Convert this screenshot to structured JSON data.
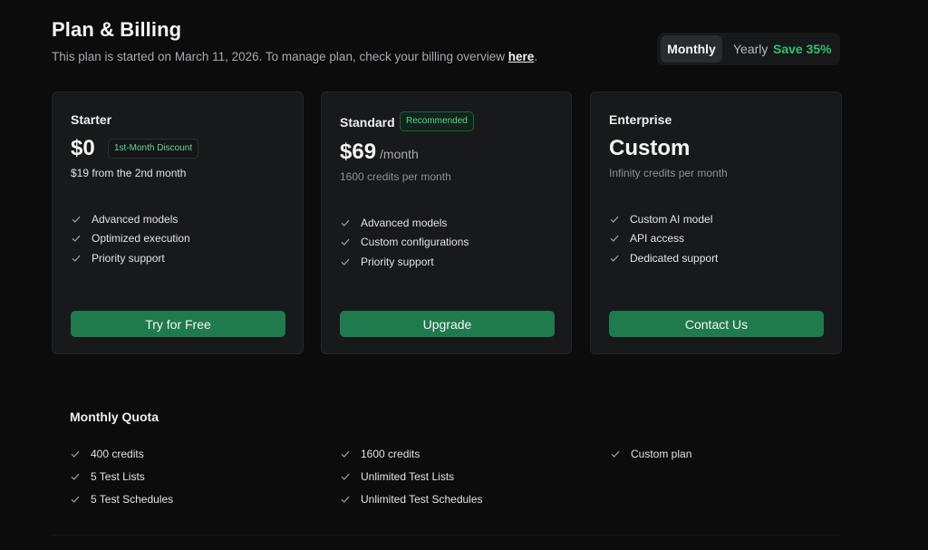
{
  "header": {
    "title": "Plan & Billing",
    "subtitle_prefix": "This plan is started on March 11, 2026. To manage plan, check your billing overview ",
    "subtitle_link": "here",
    "subtitle_suffix": "."
  },
  "billing_toggle": {
    "monthly_label": "Monthly",
    "yearly_label": "Yearly",
    "save_label": "Save 35%",
    "selected": "Monthly"
  },
  "plans": [
    {
      "name": "Starter",
      "price": "$0",
      "badge": "1st-Month Discount",
      "note": "$19 from the 2nd month",
      "features": [
        "Advanced models",
        "Optimized execution",
        "Priority support"
      ],
      "cta": "Try for Free"
    },
    {
      "name": "Standard",
      "badge": "Recommended",
      "price": "$69",
      "price_suffix": "/month",
      "note": "1600 credits per month",
      "features": [
        "Advanced models",
        "Custom configurations",
        "Priority support"
      ],
      "cta": "Upgrade"
    },
    {
      "name": "Enterprise",
      "price": "Custom",
      "note": "Infinity credits per month",
      "features": [
        "Custom AI model",
        "API access",
        "Dedicated support"
      ],
      "cta": "Contact Us"
    }
  ],
  "quota": {
    "title": "Monthly Quota",
    "columns": [
      [
        "400 credits",
        "5 Test Lists",
        "5 Test Schedules"
      ],
      [
        "1600 credits",
        "Unlimited Test Lists",
        "Unlimited Test Schedules"
      ],
      [
        "Custom plan"
      ]
    ]
  },
  "colors": {
    "background": "#0c0c0d",
    "card": "#18191b",
    "accent_green": "#1f7a4d",
    "save_green": "#2fbf71"
  },
  "icons": {
    "feature_check": "check-icon"
  }
}
